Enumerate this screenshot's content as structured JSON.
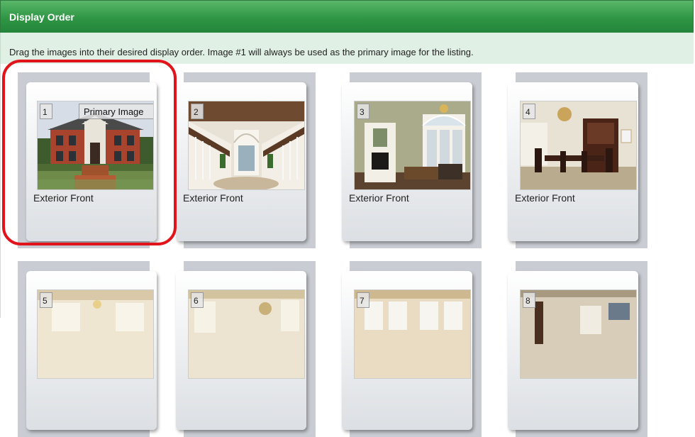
{
  "header": {
    "title": "Display Order"
  },
  "instruction": {
    "text": "Drag the images into their desired display order. Image #1 will always be used as the primary image for the listing."
  },
  "primary_badge": "Primary Image",
  "highlight_color": "#e0141a",
  "header_color": "#2f9644",
  "tiles": [
    {
      "number": "1",
      "caption": "Exterior Front"
    },
    {
      "number": "2",
      "caption": "Exterior Front"
    },
    {
      "number": "3",
      "caption": "Exterior Front"
    },
    {
      "number": "4",
      "caption": "Exterior Front"
    },
    {
      "number": "5",
      "caption": ""
    },
    {
      "number": "6",
      "caption": ""
    },
    {
      "number": "7",
      "caption": ""
    },
    {
      "number": "8",
      "caption": ""
    }
  ]
}
